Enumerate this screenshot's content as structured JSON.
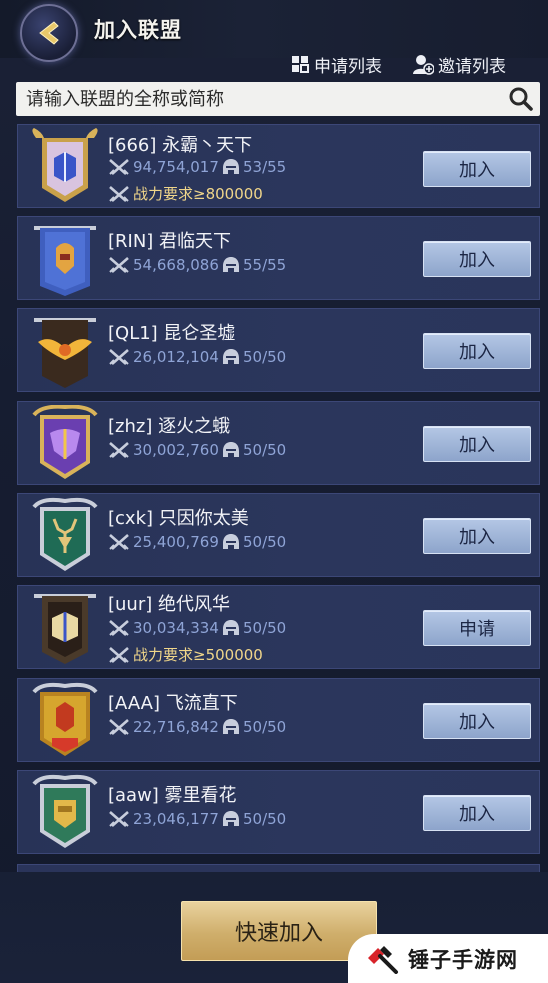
{
  "header": {
    "title": "加入联盟",
    "apply_list_label": "申请列表",
    "invite_list_label": "邀请列表"
  },
  "search": {
    "placeholder": "请输入联盟的全称或简称"
  },
  "alliances": [
    {
      "name": "[666] 永霸丶天下",
      "power": "94,754,017",
      "members": "53/55",
      "requirement": "战力要求≥800000",
      "action": "加入",
      "emblem": "gold-purple-book-shield-icon",
      "emblem_color": "#c9a14a"
    },
    {
      "name": "[RIN] 君临天下",
      "power": "54,668,086",
      "members": "55/55",
      "requirement": "",
      "action": "加入",
      "emblem": "blue-banner-knight-icon",
      "emblem_color": "#3f5fbf"
    },
    {
      "name": "[QL1] 昆仑圣墟",
      "power": "26,012,104",
      "members": "50/50",
      "requirement": "",
      "action": "加入",
      "emblem": "dark-winged-phoenix-icon",
      "emblem_color": "#3a2a1e"
    },
    {
      "name": "[zhz] 逐火之蛾",
      "power": "30,002,760",
      "members": "50/50",
      "requirement": "",
      "action": "加入",
      "emblem": "purple-moth-shield-icon",
      "emblem_color": "#6a3fb0"
    },
    {
      "name": "[cxk] 只因你太美",
      "power": "25,400,769",
      "members": "50/50",
      "requirement": "",
      "action": "加入",
      "emblem": "green-stag-shield-icon",
      "emblem_color": "#1f6b55"
    },
    {
      "name": "[uur] 绝代风华",
      "power": "30,034,334",
      "members": "50/50",
      "requirement": "战力要求≥500000",
      "action": "申请",
      "emblem": "dark-book-banner-icon",
      "emblem_color": "#4a3a2a"
    },
    {
      "name": "[AAA] 飞流直下",
      "power": "22,716,842",
      "members": "50/50",
      "requirement": "",
      "action": "加入",
      "emblem": "gold-scorpion-shield-icon",
      "emblem_color": "#d6a62e"
    },
    {
      "name": "[aaw] 雾里看花",
      "power": "23,046,177",
      "members": "50/50",
      "requirement": "",
      "action": "加入",
      "emblem": "green-gold-fist-shield-icon",
      "emblem_color": "#2f7a5a"
    }
  ],
  "footer": {
    "quick_join_label": "快速加入"
  },
  "watermark": {
    "text": "锤子手游网"
  },
  "colors": {
    "row_bg": "#2a355b",
    "button": "#9fb5da",
    "requirement_text": "#f0d68a",
    "stat_text": "#8fa4d6",
    "gold_button": "#d8b877"
  }
}
